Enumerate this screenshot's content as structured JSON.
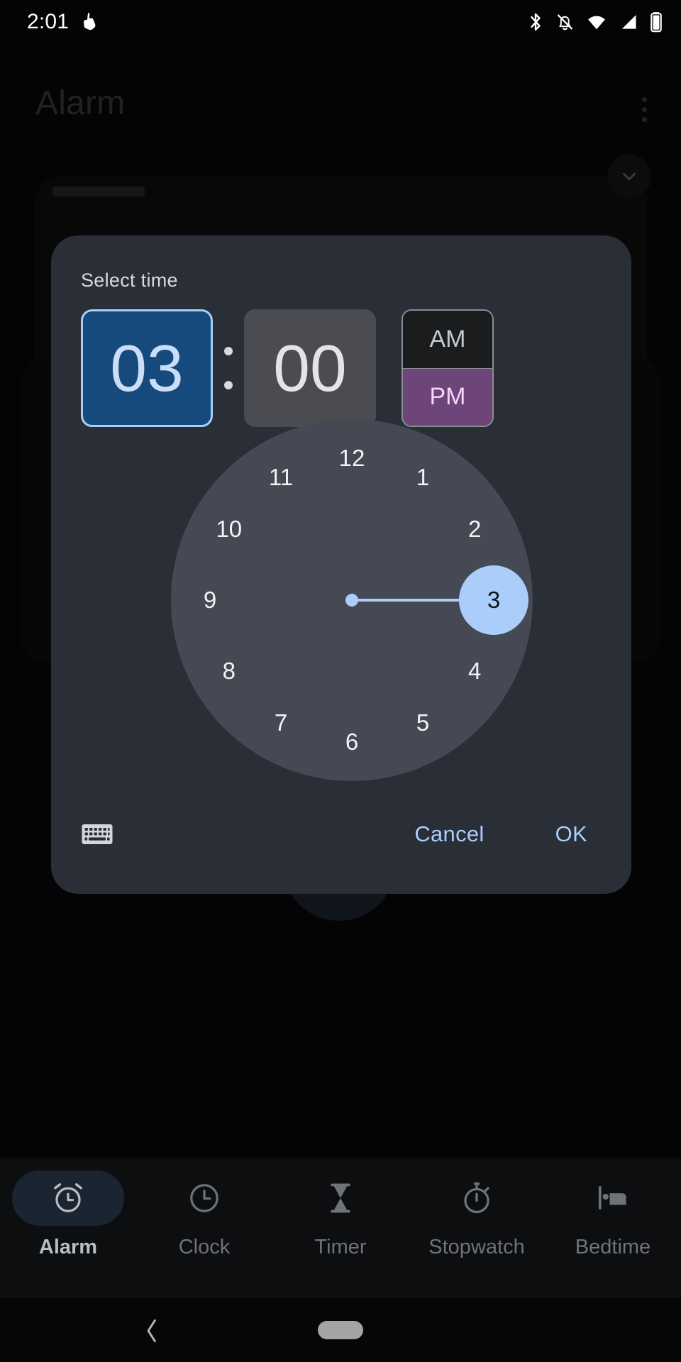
{
  "status_bar": {
    "time": "2:01",
    "left_icons": [
      "touch-indicator-icon"
    ],
    "right_icons": [
      "bluetooth-icon",
      "notifications-off-icon",
      "wifi-icon",
      "cellular-signal-icon",
      "battery-icon"
    ]
  },
  "app": {
    "title": "Alarm",
    "overflow_menu_label": "More options"
  },
  "dialog": {
    "title": "Select time",
    "hour": "03",
    "separator": ":",
    "minute": "00",
    "am_label": "AM",
    "pm_label": "PM",
    "selected_period": "PM",
    "selected_field": "hour",
    "keyboard_toggle_label": "Switch to text input mode",
    "cancel_label": "Cancel",
    "ok_label": "OK",
    "colors": {
      "surface": "#2a2e36",
      "selected_field_fill": "#164a7d",
      "selected_field_border": "#a9cefa",
      "selected_field_text": "#c9defa",
      "unselected_field_fill": "#4a4c51",
      "accent": "#a9cefa",
      "pm_fill": "#6d4579",
      "pm_text": "#f3d5f8",
      "dial_face": "#454954"
    },
    "clock": {
      "numbers": [
        "12",
        "1",
        "2",
        "3",
        "4",
        "5",
        "6",
        "7",
        "8",
        "9",
        "10",
        "11"
      ],
      "selected_number": "3",
      "hand_angle_degrees": 0
    }
  },
  "bottom_nav": {
    "items": [
      {
        "label": "Alarm",
        "icon": "alarm-clock-icon",
        "active": true
      },
      {
        "label": "Clock",
        "icon": "clock-icon",
        "active": false
      },
      {
        "label": "Timer",
        "icon": "hourglass-icon",
        "active": false
      },
      {
        "label": "Stopwatch",
        "icon": "stopwatch-icon",
        "active": false
      },
      {
        "label": "Bedtime",
        "icon": "bed-icon",
        "active": false
      }
    ]
  },
  "system_nav": {
    "back_label": "Back",
    "home_label": "Home"
  }
}
